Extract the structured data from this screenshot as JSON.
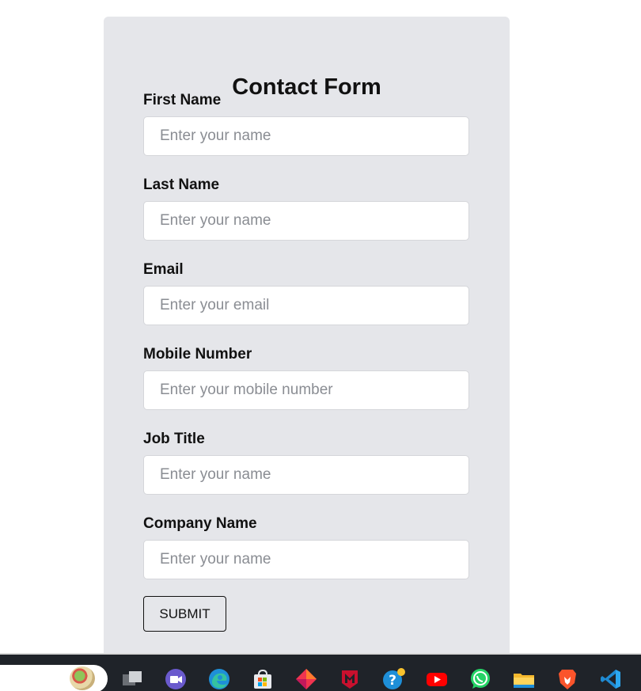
{
  "form": {
    "title": "Contact Form",
    "fields": [
      {
        "label": "First Name",
        "placeholder": "Enter your name"
      },
      {
        "label": "Last Name",
        "placeholder": "Enter your name"
      },
      {
        "label": "Email",
        "placeholder": "Enter your email"
      },
      {
        "label": "Mobile Number",
        "placeholder": "Enter your mobile number"
      },
      {
        "label": "Job Title",
        "placeholder": "Enter your name"
      },
      {
        "label": "Company Name",
        "placeholder": "Enter your name"
      }
    ],
    "submit_label": "SUBMIT"
  },
  "taskbar": {
    "icons": [
      "search-widget-icon",
      "task-view-icon",
      "meet-video-icon",
      "edge-browser-icon",
      "microsoft-store-icon",
      "diamond-app-icon",
      "mcafee-icon",
      "help-icon",
      "youtube-icon",
      "whatsapp-icon",
      "file-explorer-icon",
      "brave-browser-icon",
      "vscode-icon"
    ]
  }
}
